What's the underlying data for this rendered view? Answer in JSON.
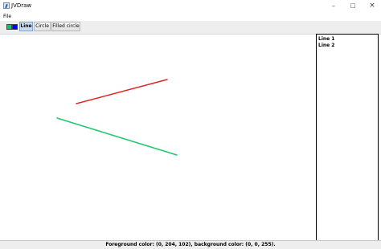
{
  "window": {
    "title": "JVDraw",
    "controls": {
      "minimize": "–",
      "maximize": "□",
      "close": "×"
    }
  },
  "menu": {
    "items": [
      "File"
    ]
  },
  "toolbar": {
    "foreground_color": "#00cc66",
    "background_color": "#0000ff",
    "tools": [
      "Line",
      "Circle",
      "Filled circle"
    ],
    "selected_tool": "Line"
  },
  "objects": [
    "Line 1",
    "Line 2"
  ],
  "canvas": {
    "lines": [
      {
        "name": "Line 1",
        "color": "#e02424"
      },
      {
        "name": "Line 2",
        "color": "#1ec86e"
      }
    ]
  },
  "status": {
    "text": "Foreground color: (0, 204, 102), background color: (0, 0, 255)."
  }
}
